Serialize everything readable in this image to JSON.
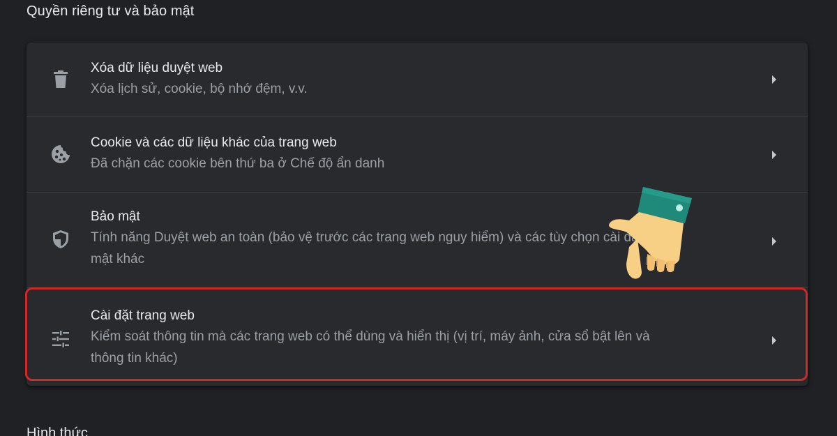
{
  "header": {
    "section_title": "Quyền riêng tư và bảo mật",
    "next_section_title": "Hình thức"
  },
  "items": [
    {
      "title": "Xóa dữ liệu duyệt web",
      "description": "Xóa lịch sử, cookie, bộ nhớ đệm, v.v.",
      "icon": "trash-icon"
    },
    {
      "title": "Cookie và các dữ liệu khác của trang web",
      "description": "Đã chặn các cookie bên thứ ba ở Chế độ ẩn danh",
      "icon": "cookie-icon"
    },
    {
      "title": "Bảo mật",
      "description_line1": "Tính năng Duyệt web an toàn (bảo vệ trước các trang web nguy hiểm) và các tùy chọn cài đặt bảo",
      "description_line2": "mật khác",
      "icon": "shield-icon"
    },
    {
      "title": "Cài đặt trang web",
      "description_line1": "Kiểm soát thông tin mà các trang web có thể dùng và hiển thị (vị trí, máy ảnh, cửa sổ bật lên và",
      "description_line2": "thông tin khác)",
      "icon": "sliders-icon"
    }
  ],
  "colors": {
    "background": "#202124",
    "card": "#292a2d",
    "title_text": "#e8eaed",
    "secondary_text": "#9aa0a6",
    "highlight_border": "#d12828",
    "hand_cuff": "#1f8a7a",
    "hand_skin": "#f7cf85"
  },
  "annotation": {
    "highlighted_item": "Cài đặt trang web",
    "pointer": "pointing-hand-icon"
  }
}
